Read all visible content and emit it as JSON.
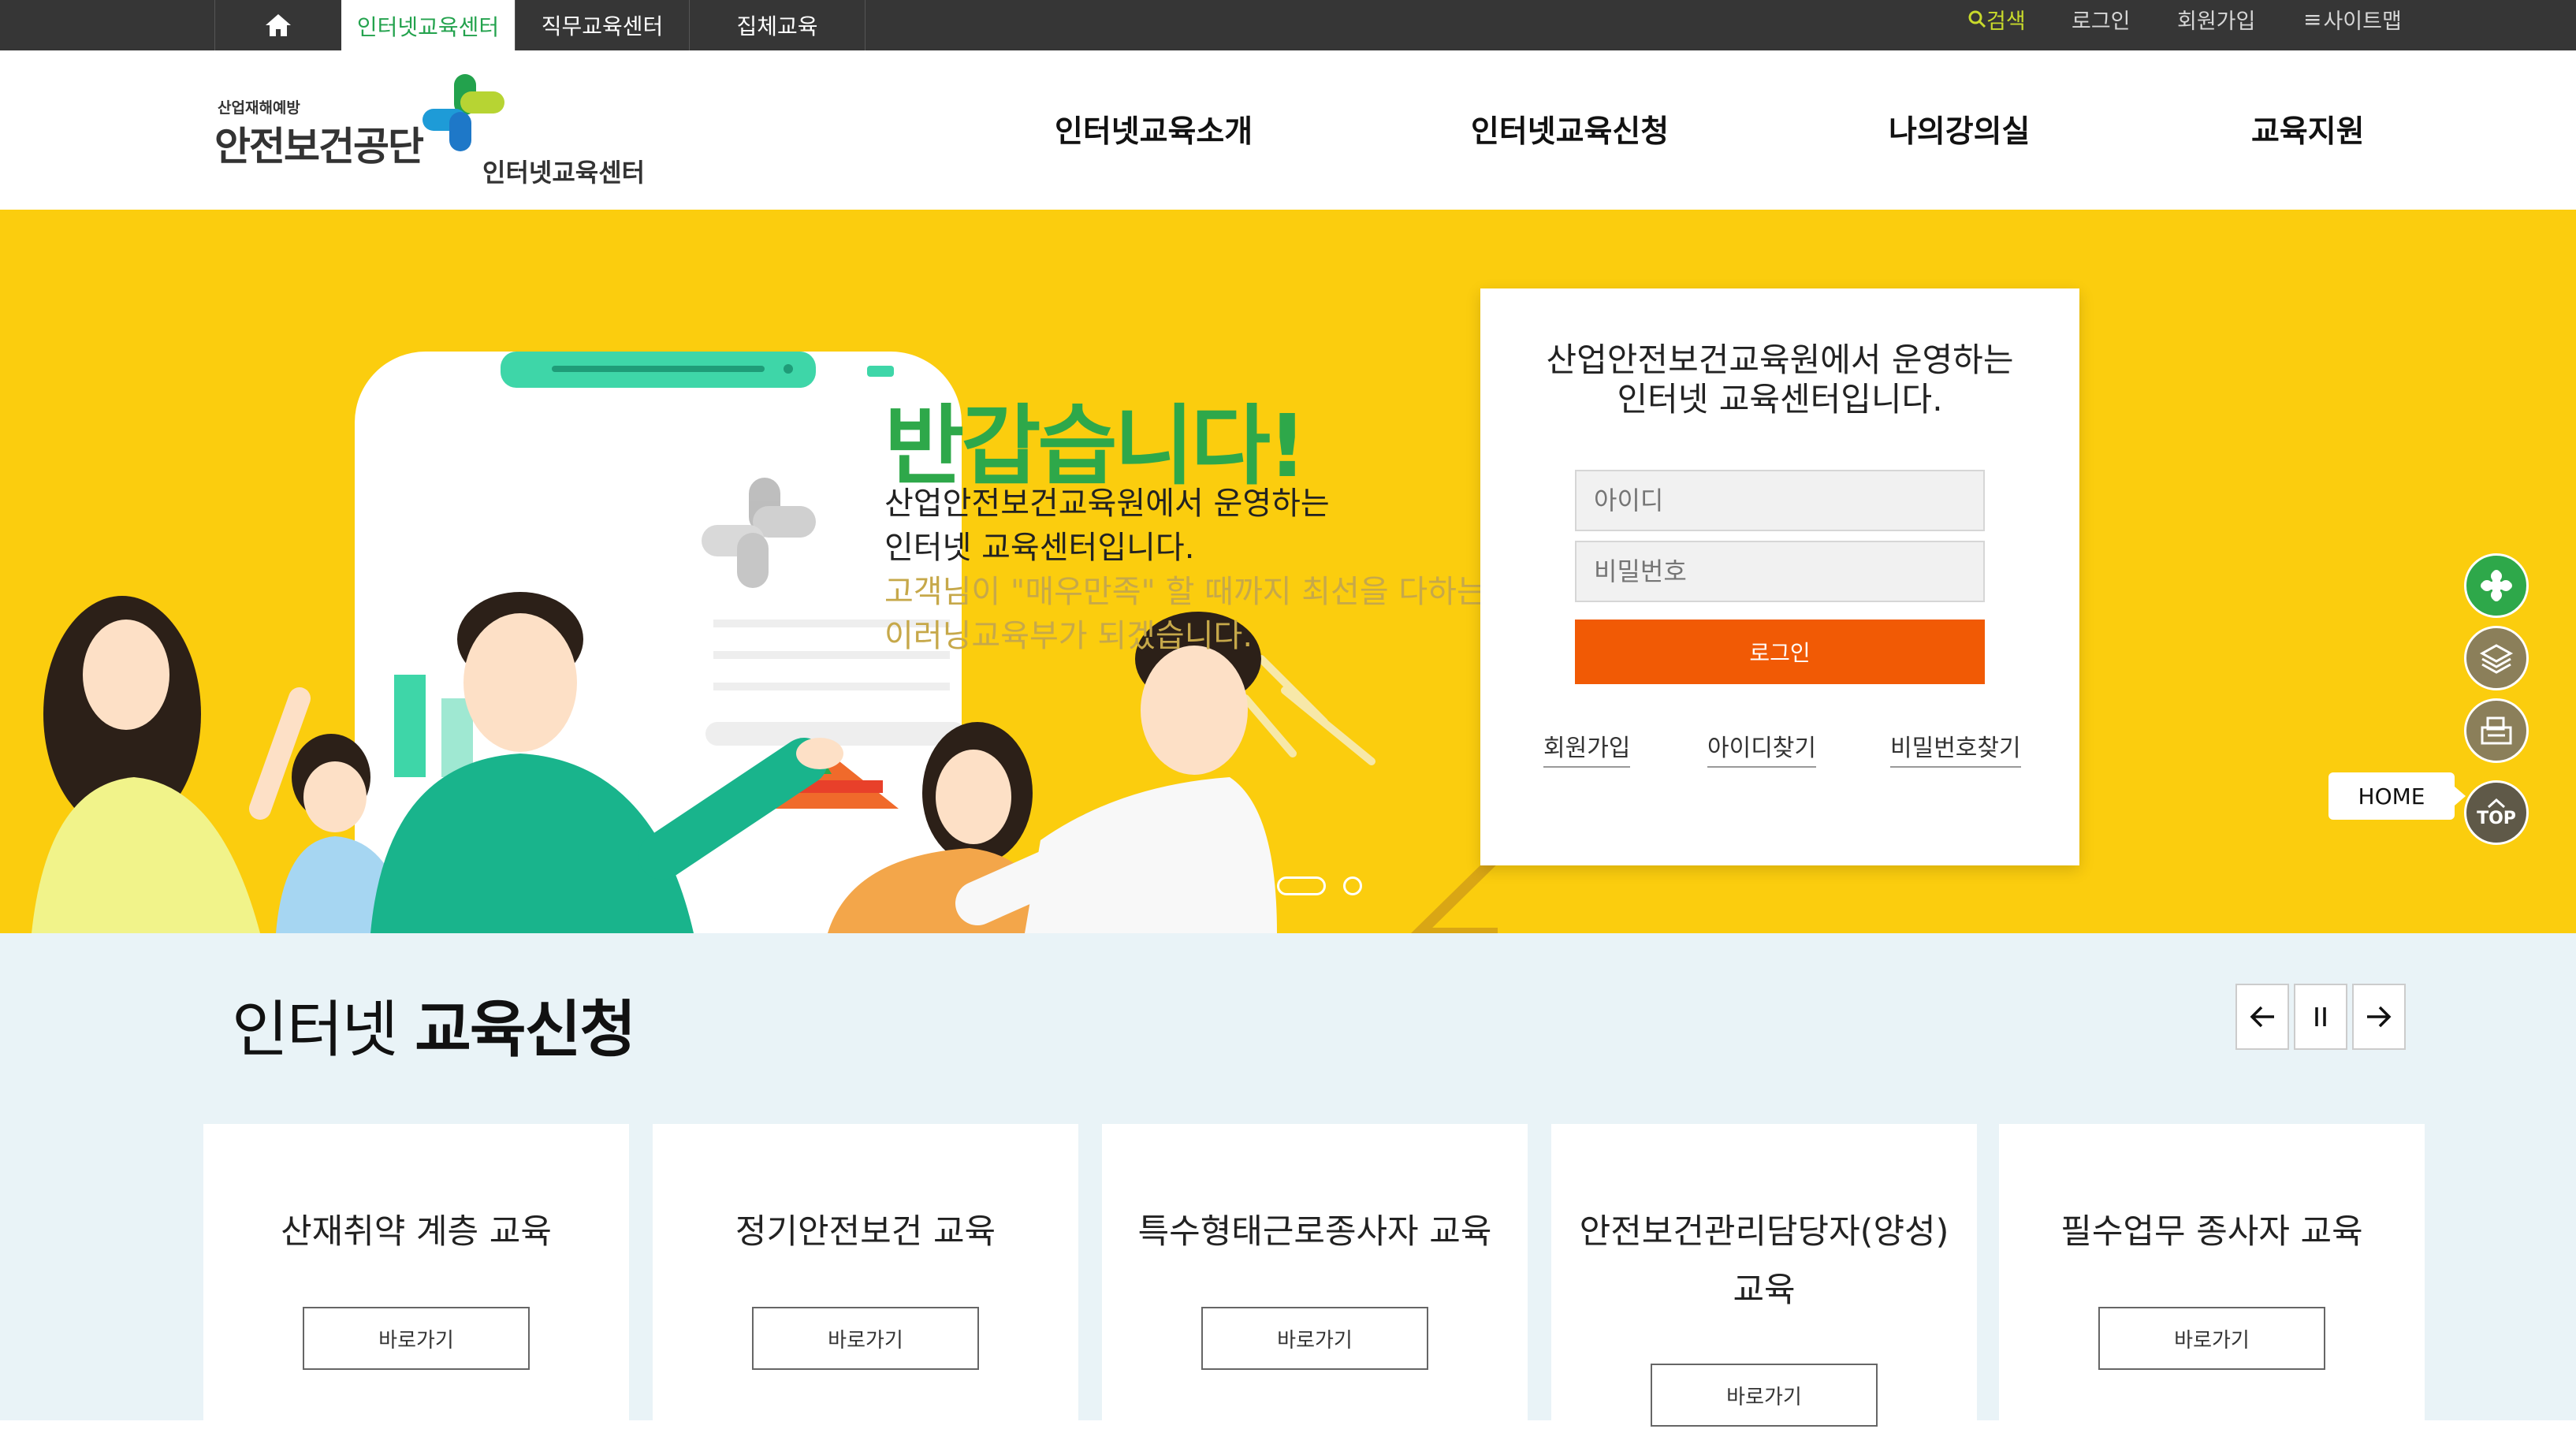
{
  "topbar": {
    "tabs": [
      "인터넷교육센터",
      "직무교육센터",
      "집체교육"
    ],
    "search": "검색",
    "login": "로그인",
    "signup": "회원가입",
    "sitemap": "사이트맵"
  },
  "logo": {
    "tagline": "산업재해예방",
    "org": "안전보건공단",
    "center": "인터넷교육센터"
  },
  "gnb": [
    "인터넷교육소개",
    "인터넷교육신청",
    "나의강의실",
    "교육지원"
  ],
  "hero": {
    "title": "반갑습니다!",
    "line1": "산업안전보건교육원에서 운영하는",
    "line2": "인터넷 교육센터입니다.",
    "line3": "고객님이 \"매우만족\" 할 때까지 최선을 다하는",
    "line4": "이러닝교육부가 되겠습니다."
  },
  "login": {
    "intro_line1": "산업안전보건교육원에서 운영하는",
    "intro_line2": "인터넷 교육센터입니다.",
    "id_placeholder": "아이디",
    "pw_placeholder": "비밀번호",
    "login_button": "로그인",
    "links": [
      "회원가입",
      "아이디찾기",
      "비밀번호찾기"
    ]
  },
  "quick": {
    "home_label": "HOME",
    "top_label": "TOP"
  },
  "section": {
    "title_light": "인터넷 ",
    "title_bold": "교육신청"
  },
  "cards": [
    {
      "title": "산재취약 계층 교육",
      "button": "바로가기"
    },
    {
      "title": "정기안전보건 교육",
      "button": "바로가기"
    },
    {
      "title": "특수형태근로종사자 교육",
      "button": "바로가기"
    },
    {
      "title": "안전보건관리담당자(양성) 교육",
      "button": "바로가기"
    },
    {
      "title": "필수업무 종사자 교육",
      "button": "바로가기"
    }
  ],
  "colors": {
    "hero_bg": "#fbcd0e",
    "accent_green": "#2ea84a",
    "login_orange": "#f15a05",
    "topbar_bg": "#363636",
    "lower_bg": "#e9f3f7"
  }
}
